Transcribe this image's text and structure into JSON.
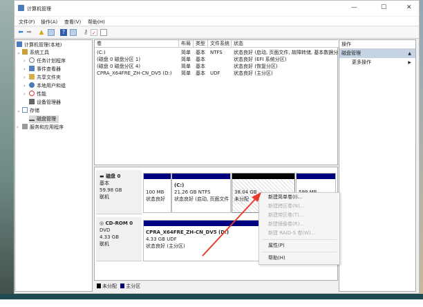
{
  "window": {
    "title": "计算机管理",
    "minimize": "—",
    "maximize": "☐",
    "close": "✕"
  },
  "menu": [
    "文件(F)",
    "操作(A)",
    "查看(V)",
    "帮助(H)"
  ],
  "tree": {
    "root": "计算机管理(本地)",
    "system_tools": "系统工具",
    "task_scheduler": "任务计划程序",
    "event_viewer": "事件查看器",
    "shared_folders": "共享文件夹",
    "local_users": "本地用户和组",
    "performance": "性能",
    "device_manager": "设备管理器",
    "storage": "存储",
    "disk_management": "磁盘管理",
    "services": "服务和应用程序"
  },
  "volumes": {
    "headers": [
      "卷",
      "布局",
      "类型",
      "文件系统",
      "状态"
    ],
    "rows": [
      [
        "(C:)",
        "简单",
        "基本",
        "NTFS",
        "状态良好 (启动, 页面文件, 故障转储, 基本数据分"
      ],
      [
        "(磁盘 0 磁盘分区 1)",
        "简单",
        "基本",
        "",
        "状态良好 (EFI 系统分区)"
      ],
      [
        "(磁盘 0 磁盘分区 4)",
        "简单",
        "基本",
        "",
        "状态良好 (恢复分区)"
      ],
      [
        "CPRA_X64FRE_ZH-CN_DV5 (D:)",
        "简单",
        "基本",
        "UDF",
        "状态良好 (主分区)"
      ]
    ]
  },
  "disks": {
    "disk0": {
      "name": "磁盘 0",
      "type": "基本",
      "size": "59.98 GB",
      "status": "联机",
      "partitions": [
        {
          "title": "",
          "size": "100 MB",
          "status": "状态良好"
        },
        {
          "title": "(C:)",
          "size": "21.26 GB NTFS",
          "status": "状态良好 (启动, 页面文件"
        },
        {
          "title": "",
          "size": "38.04 GB",
          "status": "未分配"
        },
        {
          "title": "",
          "size": "599 MB",
          "status": ""
        }
      ]
    },
    "cdrom0": {
      "name": "CD-ROM 0",
      "type": "DVD",
      "size": "4.33 GB",
      "status": "联机",
      "partition": {
        "title": "CPRA_X64FRE_ZH-CN_DV5  (D:)",
        "size": "4.33 GB UDF",
        "status": "状态良好 (主分区)"
      }
    }
  },
  "legend": [
    {
      "label": "未分配",
      "color": "#000000"
    },
    {
      "label": "主分区",
      "color": "#00007f"
    }
  ],
  "actions": {
    "header": "操作",
    "selected": "磁盘管理",
    "more": "更多操作"
  },
  "context_menu": {
    "items": [
      "新建简单卷(I)...",
      "新建跨区卷(N)...",
      "新建带区卷(T)...",
      "新建镜像卷(R)...",
      "新建 RAID-5 卷(W)..."
    ],
    "properties": "属性(P)",
    "help": "帮助(H)"
  },
  "colors": {
    "primary_partition": "#00007f",
    "unallocated": "#000000",
    "annotation_arrow": "#e8392b"
  }
}
